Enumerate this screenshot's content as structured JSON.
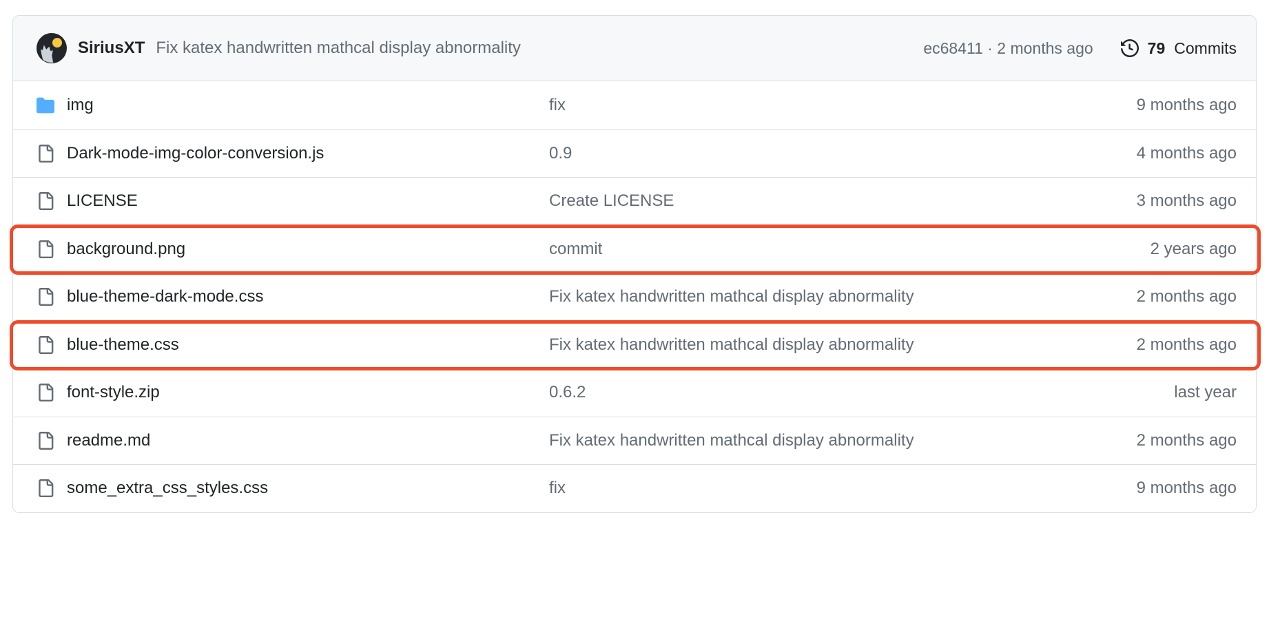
{
  "colors": {
    "highlight": "#ee4b2b",
    "header_bg": "#f6f8fa",
    "border": "#d8dee4",
    "folder_icon": "#54aeff",
    "text_primary": "#1f2328",
    "text_muted": "#636c76"
  },
  "commit_header": {
    "avatar_alt": "SiriusXT",
    "author": "SiriusXT",
    "message": "Fix katex handwritten mathcal display abnormality",
    "commit_ref": "ec68411 · 2 months ago",
    "commits_count": "79",
    "commits_label": "Commits",
    "history_icon": "history-icon"
  },
  "files": [
    {
      "icon": "folder-icon",
      "type": "directory",
      "name": "img",
      "message": "fix",
      "time": "9 months ago",
      "highlighted": false
    },
    {
      "icon": "file-icon",
      "type": "file",
      "name": "Dark-mode-img-color-conversion.js",
      "message": "0.9",
      "time": "4 months ago",
      "highlighted": false
    },
    {
      "icon": "file-icon",
      "type": "file",
      "name": "LICENSE",
      "message": "Create LICENSE",
      "time": "3 months ago",
      "highlighted": false
    },
    {
      "icon": "file-icon",
      "type": "file",
      "name": "background.png",
      "message": "commit",
      "time": "2 years ago",
      "highlighted": true
    },
    {
      "icon": "file-icon",
      "type": "file",
      "name": "blue-theme-dark-mode.css",
      "message": "Fix katex handwritten mathcal display abnormality",
      "time": "2 months ago",
      "highlighted": false
    },
    {
      "icon": "file-icon",
      "type": "file",
      "name": "blue-theme.css",
      "message": "Fix katex handwritten mathcal display abnormality",
      "time": "2 months ago",
      "highlighted": true
    },
    {
      "icon": "file-icon",
      "type": "file",
      "name": "font-style.zip",
      "message": "0.6.2",
      "time": "last year",
      "highlighted": false
    },
    {
      "icon": "file-icon",
      "type": "file",
      "name": "readme.md",
      "message": "Fix katex handwritten mathcal display abnormality",
      "time": "2 months ago",
      "highlighted": false
    },
    {
      "icon": "file-icon",
      "type": "file",
      "name": "some_extra_css_styles.css",
      "message": "fix",
      "time": "9 months ago",
      "highlighted": false
    }
  ]
}
